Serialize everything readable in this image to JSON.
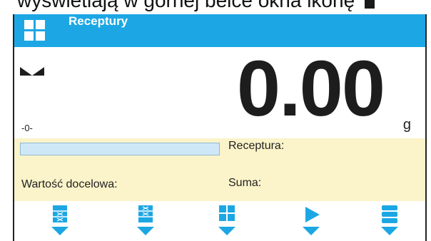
{
  "document": {
    "text": "wyświetlają w górnej belce okna ikonę"
  },
  "window": {
    "title": "Receptury",
    "title_icon": "grid-icon"
  },
  "weighing": {
    "value": "0.00",
    "unit": "g",
    "stable_icon": "stability-icon",
    "zero_label": "-0-"
  },
  "info": {
    "progress": 0,
    "recipe_label": "Receptura:",
    "target_label": "Wartość docelowa:",
    "sum_label": "Suma:"
  },
  "buttons": [
    {
      "icon": "recipe-list-icon"
    },
    {
      "icon": "recipe-steps-icon"
    },
    {
      "icon": "menu-grid-icon"
    },
    {
      "icon": "play-icon"
    },
    {
      "icon": "database-icon"
    }
  ],
  "colors": {
    "accent": "#1ca7e4",
    "info_bg": "#fbf3c9",
    "progress_bg": "#cfe8f8"
  }
}
